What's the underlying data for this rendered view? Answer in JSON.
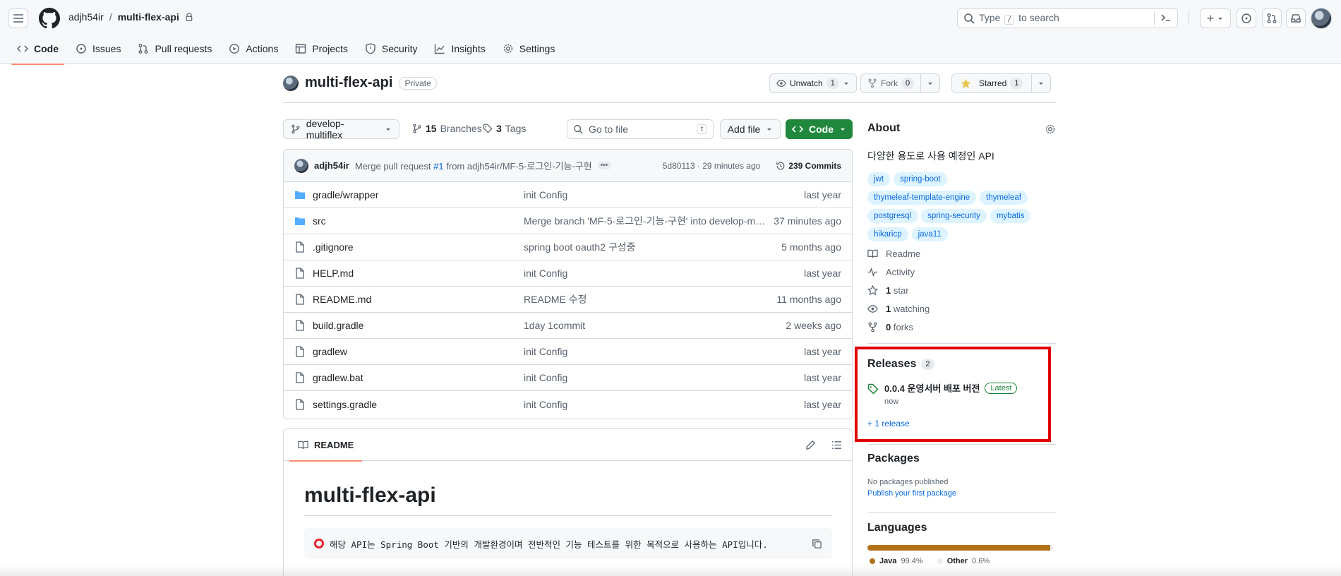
{
  "header": {
    "owner": "adjh54ir",
    "separator": "/",
    "repo": "multi-flex-api",
    "search": {
      "text_before": "Type",
      "key": "/",
      "text_after": "to search"
    },
    "plus": "+"
  },
  "tabs": [
    {
      "label": "Code",
      "icon": "code-icon",
      "active": true
    },
    {
      "label": "Issues",
      "icon": "issue-icon"
    },
    {
      "label": "Pull requests",
      "icon": "pull-request-icon"
    },
    {
      "label": "Actions",
      "icon": "play-icon"
    },
    {
      "label": "Projects",
      "icon": "table-icon"
    },
    {
      "label": "Security",
      "icon": "shield-icon"
    },
    {
      "label": "Insights",
      "icon": "graph-icon"
    },
    {
      "label": "Settings",
      "icon": "gear-icon"
    }
  ],
  "repo_head": {
    "name": "multi-flex-api",
    "visibility": "Private",
    "unwatch": {
      "label": "Unwatch",
      "count": "1"
    },
    "fork": {
      "label": "Fork",
      "count": "0"
    },
    "star": {
      "label": "Starred",
      "count": "1"
    }
  },
  "toolbar": {
    "branch": "develop-multiflex",
    "branches_count": "15",
    "branches_label": "Branches",
    "tags_count": "3",
    "tags_label": "Tags",
    "goto_placeholder": "Go to file",
    "goto_key": "t",
    "add_file": "Add file",
    "code": "Code"
  },
  "latest_commit": {
    "author": "adjh54ir",
    "msg_prefix": "Merge pull request",
    "pr": "#1",
    "msg_suffix": "from adjh54ir/MF-5-로그인-기능-구현",
    "sha_time": "5d80113 · 29 minutes ago",
    "commits": "239 Commits"
  },
  "files": [
    {
      "type": "dir",
      "name": "gradle/wrapper",
      "message": "init Config",
      "age": "last year"
    },
    {
      "type": "dir",
      "name": "src",
      "message": "Merge branch 'MF-5-로그인-기능-구현' into develop-multifl...",
      "age": "37 minutes ago"
    },
    {
      "type": "file",
      "name": ".gitignore",
      "message": "spring boot oauth2 구성중",
      "age": "5 months ago"
    },
    {
      "type": "file",
      "name": "HELP.md",
      "message": "init Config",
      "age": "last year"
    },
    {
      "type": "file",
      "name": "README.md",
      "message": "README 수정",
      "age": "11 months ago"
    },
    {
      "type": "file",
      "name": "build.gradle",
      "message": "1day 1commit",
      "age": "2 weeks ago"
    },
    {
      "type": "file",
      "name": "gradlew",
      "message": "init Config",
      "age": "last year"
    },
    {
      "type": "file",
      "name": "gradlew.bat",
      "message": "init Config",
      "age": "last year"
    },
    {
      "type": "file",
      "name": "settings.gradle",
      "message": "init Config",
      "age": "last year"
    }
  ],
  "readme": {
    "tab": "README",
    "title": "multi-flex-api",
    "note": "해당 API는 Spring Boot 기반의 개발환경이며 전반적인 기능 테스트를 위한 목적으로 사용하는 API입니다."
  },
  "about": {
    "heading": "About",
    "description": "다양한 용도로 사용 예정인 API",
    "topics": [
      "jwt",
      "spring-boot",
      "thymeleaf-template-engine",
      "thymeleaf",
      "postgresql",
      "spring-security",
      "mybatis",
      "hikaricp",
      "java11"
    ],
    "readme": "Readme",
    "activity": "Activity",
    "stars_count": "1",
    "stars_label": "star",
    "watching_count": "1",
    "watching_label": "watching",
    "forks_count": "0",
    "forks_label": "forks"
  },
  "releases": {
    "heading": "Releases",
    "count": "2",
    "latest_name": "0.0.4 운영서버 배포 버전",
    "latest_badge": "Latest",
    "latest_when": "now",
    "more": "+ 1 release"
  },
  "packages": {
    "heading": "Packages",
    "none": "No packages published",
    "link": "Publish your first package"
  },
  "languages": {
    "heading": "Languages",
    "items": [
      {
        "name": "Java",
        "percent": "99.4%",
        "value": 99.4,
        "color": "#b07219"
      },
      {
        "name": "Other",
        "percent": "0.6%",
        "value": 0.6,
        "color": "#ededed"
      }
    ]
  },
  "colors": {
    "accent": "#fd8c73",
    "link": "#0969da",
    "primary_button": "#1f883d",
    "highlight_box": "#e00000"
  }
}
